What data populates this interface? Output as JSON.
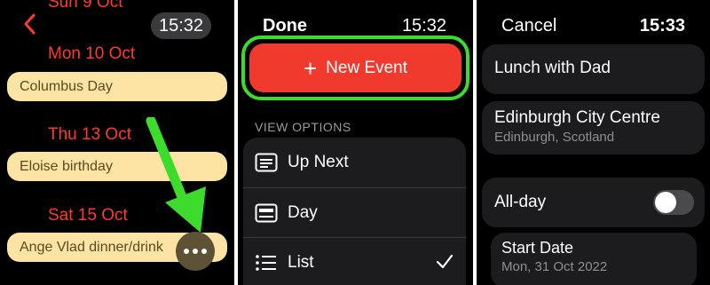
{
  "calendar": {
    "dates": [
      "Sun 9 Oct",
      "Mon 10 Oct",
      "Thu 13 Oct",
      "Sat 15 Oct"
    ],
    "events": [
      "Columbus Day",
      "Eloise birthday",
      "Ange Vlad dinner/drink"
    ],
    "time": "15:32",
    "more_icon": "ellipsis-icon",
    "accent": "#ff3b30",
    "event_color": "#fde4a5",
    "arrow_color": "#3ddb2c"
  },
  "options": {
    "done_label": "Done",
    "time": "15:32",
    "new_event_label": "New Event",
    "section_label": "VIEW OPTIONS",
    "items": [
      {
        "label": "Up Next",
        "icon": "up-next-icon",
        "selected": false
      },
      {
        "label": "Day",
        "icon": "day-view-icon",
        "selected": false
      },
      {
        "label": "List",
        "icon": "list-icon",
        "selected": true
      }
    ],
    "new_event_color": "#f03a2e",
    "highlight_color": "#3ddb2c"
  },
  "event_form": {
    "cancel_label": "Cancel",
    "time": "15:33",
    "title": "Lunch with Dad",
    "location": {
      "name": "Edinburgh City Centre",
      "detail": "Edinburgh, Scotland"
    },
    "allday_label": "All-day",
    "allday_on": false,
    "start_label": "Start Date",
    "start_value": "Mon, 31 Oct 2022"
  }
}
